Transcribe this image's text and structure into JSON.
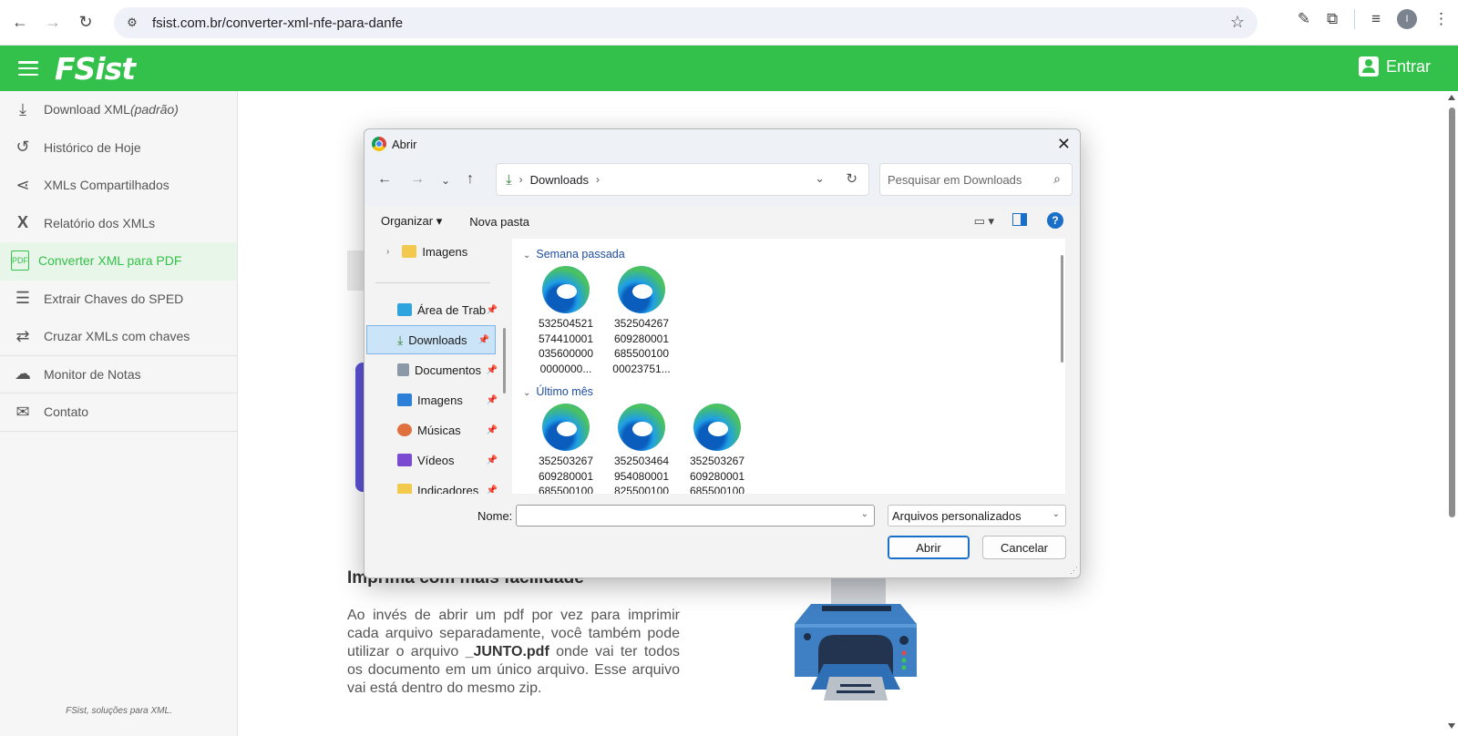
{
  "browser": {
    "url": "fsist.com.br/converter-xml-nfe-para-danfe",
    "profile_initial": "I"
  },
  "site": {
    "logo": "FSist",
    "login_label": "Entrar",
    "brand_color": "#34c14b"
  },
  "sidebar": {
    "items": [
      {
        "label": "Download XML ",
        "label_em": "(padrão)",
        "icon": "download-icon"
      },
      {
        "label": "Histórico de Hoje",
        "icon": "history-icon"
      },
      {
        "label": "XMLs Compartilhados",
        "icon": "share-icon"
      },
      {
        "label": "Relatório dos XMLs",
        "icon": "excel-icon"
      },
      {
        "label": "Converter XML para PDF",
        "icon": "pdf-icon"
      },
      {
        "label": "Extrair Chaves do SPED",
        "icon": "lines-icon"
      },
      {
        "label": "Cruzar XMLs com chaves",
        "icon": "swap-icon"
      },
      {
        "label": "Monitor de Notas",
        "icon": "cloud-icon"
      },
      {
        "label": "Contato",
        "icon": "mail-icon"
      }
    ],
    "footer": "FSist, soluções para XML."
  },
  "main": {
    "section_title": "Imprima com mais facilidade",
    "text_before": "Ao invés de abrir um pdf por vez para imprimir cada arquivo separadamente, você também pode utilizar o arquivo ",
    "text_bold": "_JUNTO.pdf",
    "text_after": " onde vai ter todos os documento em um único arquivo. Esse arquivo vai está dentro do mesmo zip."
  },
  "dialog": {
    "title": "Abrir",
    "breadcrumb": "Downloads",
    "search_placeholder": "Pesquisar em Downloads",
    "organize_label": "Organizar",
    "new_folder_label": "Nova pasta",
    "nav_items": [
      {
        "label": "Imagens",
        "type": "tree"
      },
      {
        "label": "Área de Trab",
        "pinned": true
      },
      {
        "label": "Downloads",
        "pinned": true,
        "selected": true
      },
      {
        "label": "Documentos",
        "pinned": true
      },
      {
        "label": "Imagens",
        "pinned": true
      },
      {
        "label": "Músicas",
        "pinned": true
      },
      {
        "label": "Vídeos",
        "pinned": true
      },
      {
        "label": "Indicadores",
        "pinned": true
      }
    ],
    "groups": [
      {
        "header": "Semana passada",
        "files": [
          {
            "name_lines": [
              "532504521",
              "574410001",
              "035600000",
              "0000000..."
            ]
          },
          {
            "name_lines": [
              "352504267",
              "609280001",
              "685500100",
              "00023751..."
            ]
          }
        ]
      },
      {
        "header": "Último mês",
        "files": [
          {
            "name_lines": [
              "352503267",
              "609280001",
              "685500100"
            ]
          },
          {
            "name_lines": [
              "352503464",
              "954080001",
              "825500100"
            ]
          },
          {
            "name_lines": [
              "352503267",
              "609280001",
              "685500100"
            ]
          }
        ]
      }
    ],
    "name_label": "Nome:",
    "name_value": "",
    "file_type": "Arquivos personalizados",
    "open_button": "Abrir",
    "cancel_button": "Cancelar"
  }
}
